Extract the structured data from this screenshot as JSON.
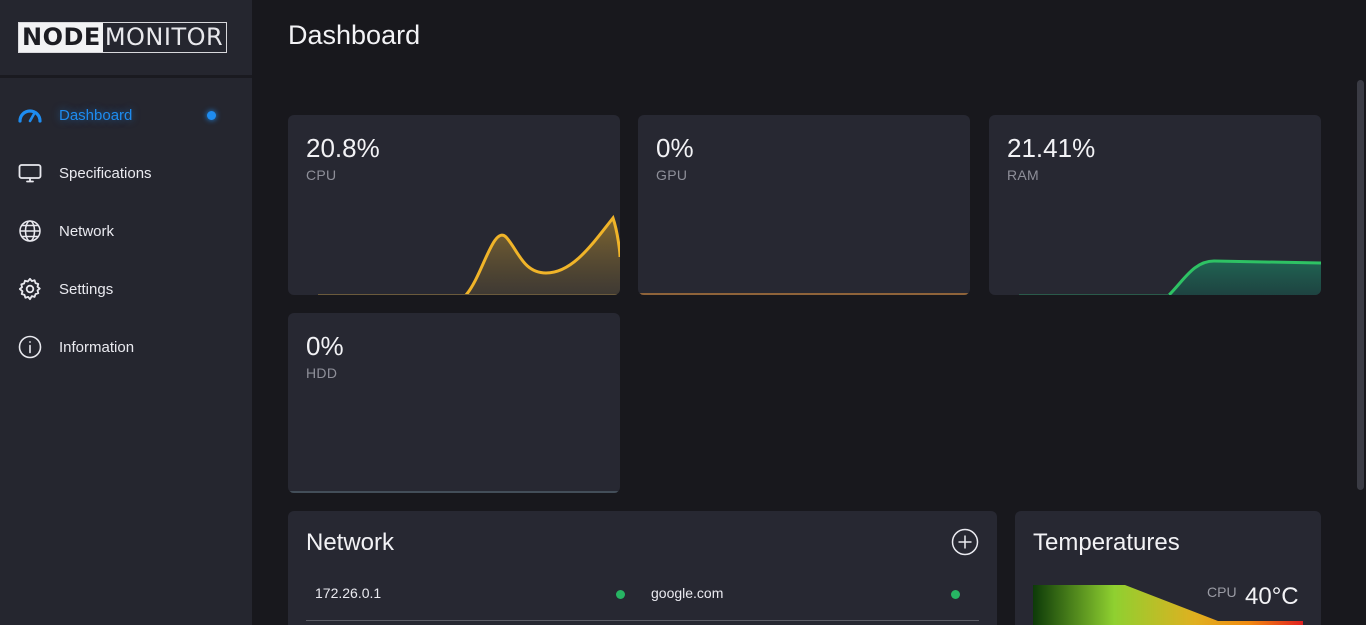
{
  "logo": {
    "part1": "NODE",
    "part2": "MONITOR"
  },
  "sidebar": {
    "items": [
      {
        "label": "Dashboard",
        "icon": "gauge-icon",
        "active": true
      },
      {
        "label": "Specifications",
        "icon": "monitor-icon"
      },
      {
        "label": "Network",
        "icon": "globe-icon"
      },
      {
        "label": "Settings",
        "icon": "gear-icon"
      },
      {
        "label": "Information",
        "icon": "info-icon"
      }
    ]
  },
  "page": {
    "title": "Dashboard"
  },
  "stats": [
    {
      "value": "20.8%",
      "label": "CPU",
      "color": "#f0b429"
    },
    {
      "value": "0%",
      "label": "GPU",
      "color": "#e9a74a"
    },
    {
      "value": "21.41%",
      "label": "RAM",
      "color": "#2ec264"
    },
    {
      "value": "0%",
      "label": "HDD",
      "color": "#6b7a8a"
    }
  ],
  "network": {
    "title": "Network",
    "hosts": [
      {
        "name": "172.26.0.1",
        "status": "online",
        "status_color": "#27b463"
      },
      {
        "name": "google.com",
        "status": "online",
        "status_color": "#27b463"
      }
    ]
  },
  "temperatures": {
    "title": "Temperatures",
    "sensor": "CPU",
    "value": "40°C"
  }
}
